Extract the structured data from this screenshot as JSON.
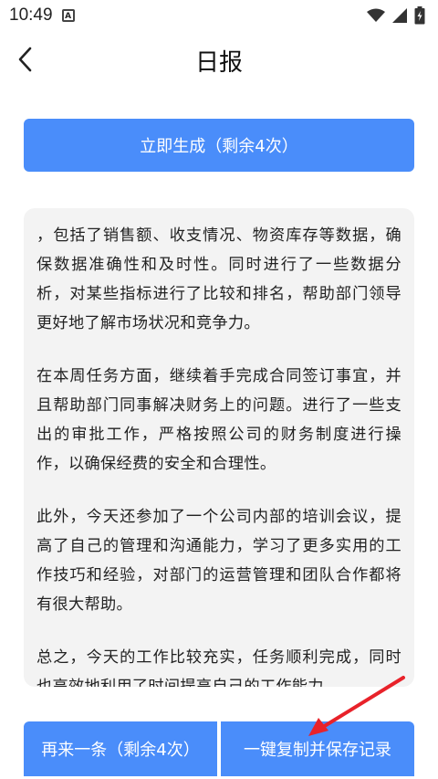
{
  "status_bar": {
    "time": "10:49",
    "notification_icon_letter": "A",
    "icons": [
      "wifi-icon",
      "signal-icon",
      "battery-icon"
    ]
  },
  "header": {
    "title": "日报",
    "back_icon": "chevron-left-icon"
  },
  "generate_button": {
    "label": "立即生成（剩余4次）"
  },
  "report": {
    "paragraphs": [
      "，包括了销售额、收支情况、物资库存等数据，确保数据准确性和及时性。同时进行了一些数据分析，对某些指标进行了比较和排名，帮助部门领导更好地了解市场状况和竞争力。",
      "在本周任务方面，继续着手完成合同签订事宜，并且帮助部门同事解决财务上的问题。进行了一些支出的审批工作，严格按照公司的财务制度进行操作，以确保经费的安全和合理性。",
      "此外，今天还参加了一个公司内部的培训会议，提高了自己的管理和沟通能力，学习了更多实用的工作技巧和经验，对部门的运营管理和团队合作都将有很大帮助。",
      "总之，今天的工作比较充实，任务顺利完成，同时也高效地利用了时间提高自己的工作能力。"
    ]
  },
  "bottom_actions": {
    "again_label": "再来一条（剩余4次）",
    "copy_save_label": "一键复制并保存记录"
  },
  "colors": {
    "accent": "#4a8dfa",
    "card_bg": "#f3f3f3",
    "annotation_arrow": "#e8222a"
  }
}
